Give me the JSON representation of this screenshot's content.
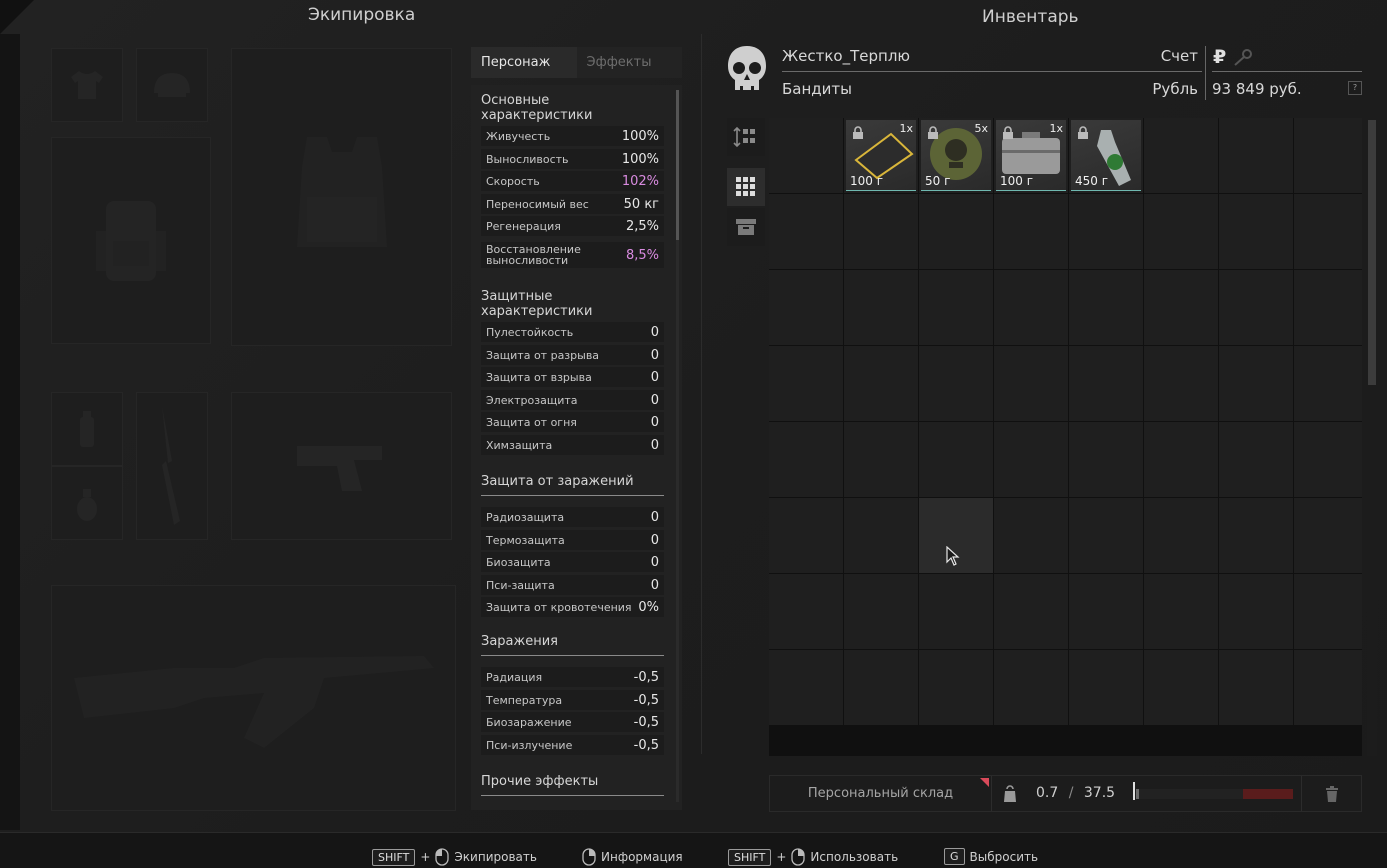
{
  "equipment": {
    "title": "Экипировка"
  },
  "inventory": {
    "title": "Инвентарь"
  },
  "tabs": {
    "character": "Персонаж",
    "effects": "Эффекты"
  },
  "stats": {
    "basic": {
      "title": "Основные характеристики",
      "rows": [
        {
          "label": "Живучесть",
          "value": "100%"
        },
        {
          "label": "Выносливость",
          "value": "100%"
        },
        {
          "label": "Скорость",
          "value": "102%"
        },
        {
          "label": "Переносимый вес",
          "value": "50 кг"
        },
        {
          "label": "Регенерация",
          "value": "2,5%"
        },
        {
          "label": "Восстановление выносливости",
          "value": "8,5%"
        }
      ]
    },
    "protective": {
      "title": "Защитные характеристики",
      "rows": [
        {
          "label": "Пулестойкость",
          "value": "0"
        },
        {
          "label": "Защита от разрыва",
          "value": "0"
        },
        {
          "label": "Защита от взрыва",
          "value": "0"
        },
        {
          "label": "Электрозащита",
          "value": "0"
        },
        {
          "label": "Защита от огня",
          "value": "0"
        },
        {
          "label": "Химзащита",
          "value": "0"
        }
      ]
    },
    "infection_protection": {
      "title": "Защита от заражений",
      "rows": [
        {
          "label": "Радиозащита",
          "value": "0"
        },
        {
          "label": "Термозащита",
          "value": "0"
        },
        {
          "label": "Биозащита",
          "value": "0"
        },
        {
          "label": "Пси-защита",
          "value": "0"
        },
        {
          "label": "Защита от кровотечения",
          "value": "0%"
        }
      ]
    },
    "infections": {
      "title": "Заражения",
      "rows": [
        {
          "label": "Радиация",
          "value": "-0,5"
        },
        {
          "label": "Температура",
          "value": "-0,5"
        },
        {
          "label": "Биозаражение",
          "value": "-0,5"
        },
        {
          "label": "Пси-излучение",
          "value": "-0,5"
        }
      ]
    },
    "other": {
      "title": "Прочие эффекты"
    }
  },
  "player": {
    "name": "Жестко_Терплю",
    "faction": "Бандиты",
    "account_label": "Счет",
    "currency_label": "Рубль",
    "money": "93 849 руб.",
    "currency_symbol": "₽",
    "help": "?"
  },
  "items": [
    {
      "count": "1x",
      "weight": "100 г",
      "icon": "document-card"
    },
    {
      "count": "5x",
      "weight": "50 г",
      "icon": "bandit-patch"
    },
    {
      "count": "1x",
      "weight": "100 г",
      "icon": "metal-case"
    },
    {
      "count": "",
      "weight": "450 г",
      "icon": "green-bottle"
    }
  ],
  "storage": {
    "label": "Персональный склад",
    "weight_current": "0.7",
    "weight_sep": "/",
    "weight_max": "37.5",
    "weight_fraction": 0.019
  },
  "hints": [
    {
      "key": "SHIFT",
      "plus": "+",
      "action": "Экипировать"
    },
    {
      "action": "Информация"
    },
    {
      "key": "SHIFT",
      "plus": "+",
      "action": "Использовать"
    },
    {
      "key": "G",
      "action": "Выбросить"
    }
  ]
}
